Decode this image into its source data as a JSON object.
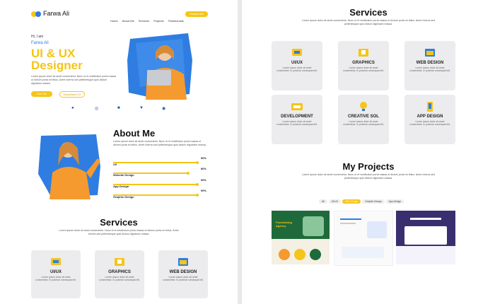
{
  "brand": {
    "name": "Farwa Ali"
  },
  "nav": [
    "Home",
    "About Me",
    "Services",
    "Projects",
    "Testimonials"
  ],
  "nav_cta": "Contact Me",
  "hero": {
    "greeting": "Hi, I am",
    "name": "Farwa Ali",
    "title_line1": "UI & UX",
    "title_line2": "Designer",
    "description": "Lorem ipsum dolor sit amet consectetur. Nunc ut et vestibulum porta massa ut dictum porta mi tellus. Amet viverra sed pellentesque quis dictum dignissim massa.",
    "btn_primary": "Hire Me",
    "btn_secondary": "Download CV"
  },
  "socials": [
    "facebook-icon",
    "dribbble-icon",
    "linkedin-icon",
    "twitter-icon",
    "whatsapp-icon"
  ],
  "about": {
    "title": "About Me",
    "description": "Lorem ipsum dolor sit amet consectetur. Nunc ut et vestibulum porta massa ut dictum porta mi tellus. Amet viverra sed pellentesque quis dictum dignissim massa.",
    "skills": [
      {
        "label": "UX",
        "percent": "90%",
        "value": 90
      },
      {
        "label": "Website Design",
        "percent": "80%",
        "value": 80
      },
      {
        "label": "App Design",
        "percent": "90%",
        "value": 90
      },
      {
        "label": "Graphic Design",
        "percent": "90%",
        "value": 90
      }
    ]
  },
  "services": {
    "title": "Services",
    "description": "Lorem ipsum dolor sit amet consectetur. Nunc ut et vestibulum porta massa ut dictum porta mi tellus. Amet viverra sed pellentesque quis dictum dignissim massa.",
    "card_desc": "Lorem ipsum dolor sit amet consectetur. In pulvinar consequat elit.",
    "items": [
      "UI/UX",
      "GRAPHICS",
      "WEB DESIGN",
      "DEVELOPMENT",
      "CREATIVE SOL",
      "APP DESIGN"
    ]
  },
  "projects": {
    "title": "My Projects",
    "description": "Lorem ipsum dolor sit amet consectetur. Nunc ut et vestibulum porta massa ut dictum porta mi tellus. Amet viverra sed pellentesque quis dictum dignissim massa.",
    "tabs": [
      "All",
      "UI/UX",
      "Web Design",
      "Graphic Design",
      "App Design"
    ],
    "active_tab": "Web Design",
    "thumb1_text": "Fundraising Agency"
  },
  "colors": {
    "accent": "#f5c518",
    "blue": "#2f7de1",
    "orange": "#f59a2e"
  }
}
